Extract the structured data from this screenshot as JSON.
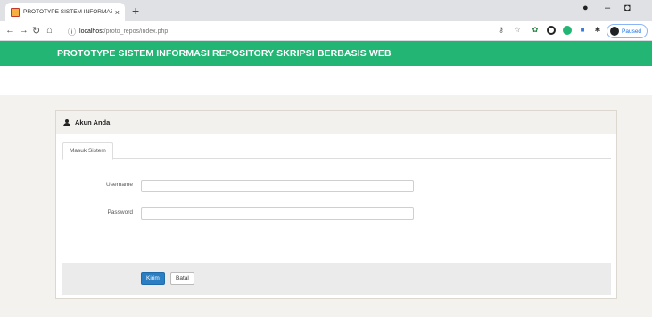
{
  "browser": {
    "tab_title": "PROTOTYPE SISTEM INFORMASI",
    "tab_close": "×",
    "new_tab": "+",
    "url_host": "localhost",
    "url_path": "/proto_repos/index.php",
    "profile_label": "Paused",
    "icons": [
      "back-arrow-icon",
      "forward-arrow-icon",
      "reload-icon",
      "home-icon",
      "info-icon",
      "key-icon",
      "star-icon",
      "extension-icon",
      "puzzle-icon"
    ]
  },
  "site": {
    "title": "PROTOTYPE SISTEM INFORMASI REPOSITORY SKRIPSI BERBASIS WEB"
  },
  "panel": {
    "heading": "Akun Anda",
    "tabs": [
      {
        "label": "Masuk Sistem"
      }
    ],
    "fields": {
      "username": {
        "label": "Username",
        "value": ""
      },
      "password": {
        "label": "Password",
        "value": ""
      }
    },
    "buttons": {
      "submit": "Kirim",
      "cancel": "Batal"
    }
  },
  "colors": {
    "header_green": "#22b573",
    "primary_button": "#2a7fc4",
    "page_background": "#f4f2ee"
  }
}
